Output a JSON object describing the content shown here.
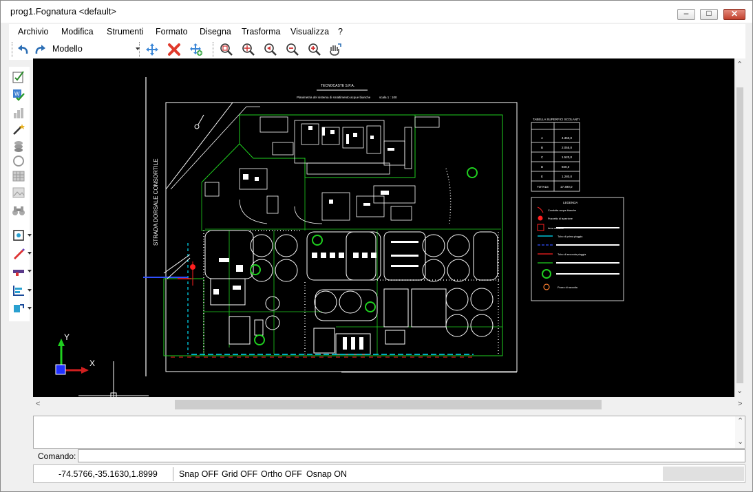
{
  "window": {
    "title": "prog1.Fognatura <default>"
  },
  "menu": [
    "Archivio",
    "Modifica",
    "Strumenti",
    "Formato",
    "Disegna",
    "Trasforma",
    "Visualizza",
    "?"
  ],
  "toolbar": {
    "space_select": "Modello",
    "icons": [
      "undo-icon",
      "redo-icon",
      "move-icon",
      "delete-icon",
      "copy-icon",
      "zoom-window-icon",
      "zoom-extents-icon",
      "zoom-previous-icon",
      "zoom-out-icon",
      "zoom-in-icon",
      "pan-icon"
    ]
  },
  "left_toolbar": {
    "icons": [
      "edit-properties-icon",
      "document-check-icon",
      "chart-icon",
      "magic-wand-icon",
      "layers-icon",
      "circle-icon",
      "grid-icon",
      "image-icon",
      "binoculars-icon",
      "snap-icon",
      "pencil-icon",
      "wall-icon",
      "dimension-icon",
      "hatch-icon"
    ]
  },
  "drawing": {
    "company": "TECNOCASTE S.P.A.",
    "sheet_title": "Planimetria del sistema di smaltimento acque bianche",
    "scale": "scala 1 : 100",
    "road_label": "STRADA DORSALE CONSORTILE",
    "table_title": "TABELLA SUPERFICI SCOLANTI",
    "table_rows": [
      [
        "A",
        "4.350,0"
      ],
      [
        "B",
        "2.055,0"
      ],
      [
        "C",
        "1.520,0"
      ],
      [
        "D",
        "920,0"
      ],
      [
        "E",
        "1.280,0"
      ],
      [
        "TOTALE",
        "17.490,0"
      ]
    ],
    "legend_title": "LEGENDA",
    "legend_items": [
      "Condotta acque bianche",
      "Pozzetto di ispezione",
      "Area scolante",
      "Tubo di prima pioggia",
      "Tubo di seconda pioggia",
      "Pozzo di raccolta"
    ],
    "ucs": {
      "y": "Y",
      "x": "X"
    },
    "colors": {
      "background": "#000000",
      "lines": "#ffffff",
      "green": "#1fd01f",
      "cyan": "#00e5ff",
      "red": "#ff2020",
      "blue": "#3050ff"
    }
  },
  "command": {
    "label": "Comando:",
    "value": ""
  },
  "status": {
    "coords": "-74.5766,-35.1630,1.8999",
    "snap": "Snap OFF",
    "grid": "Grid OFF",
    "ortho": "Ortho OFF",
    "osnap": "Osnap ON"
  }
}
